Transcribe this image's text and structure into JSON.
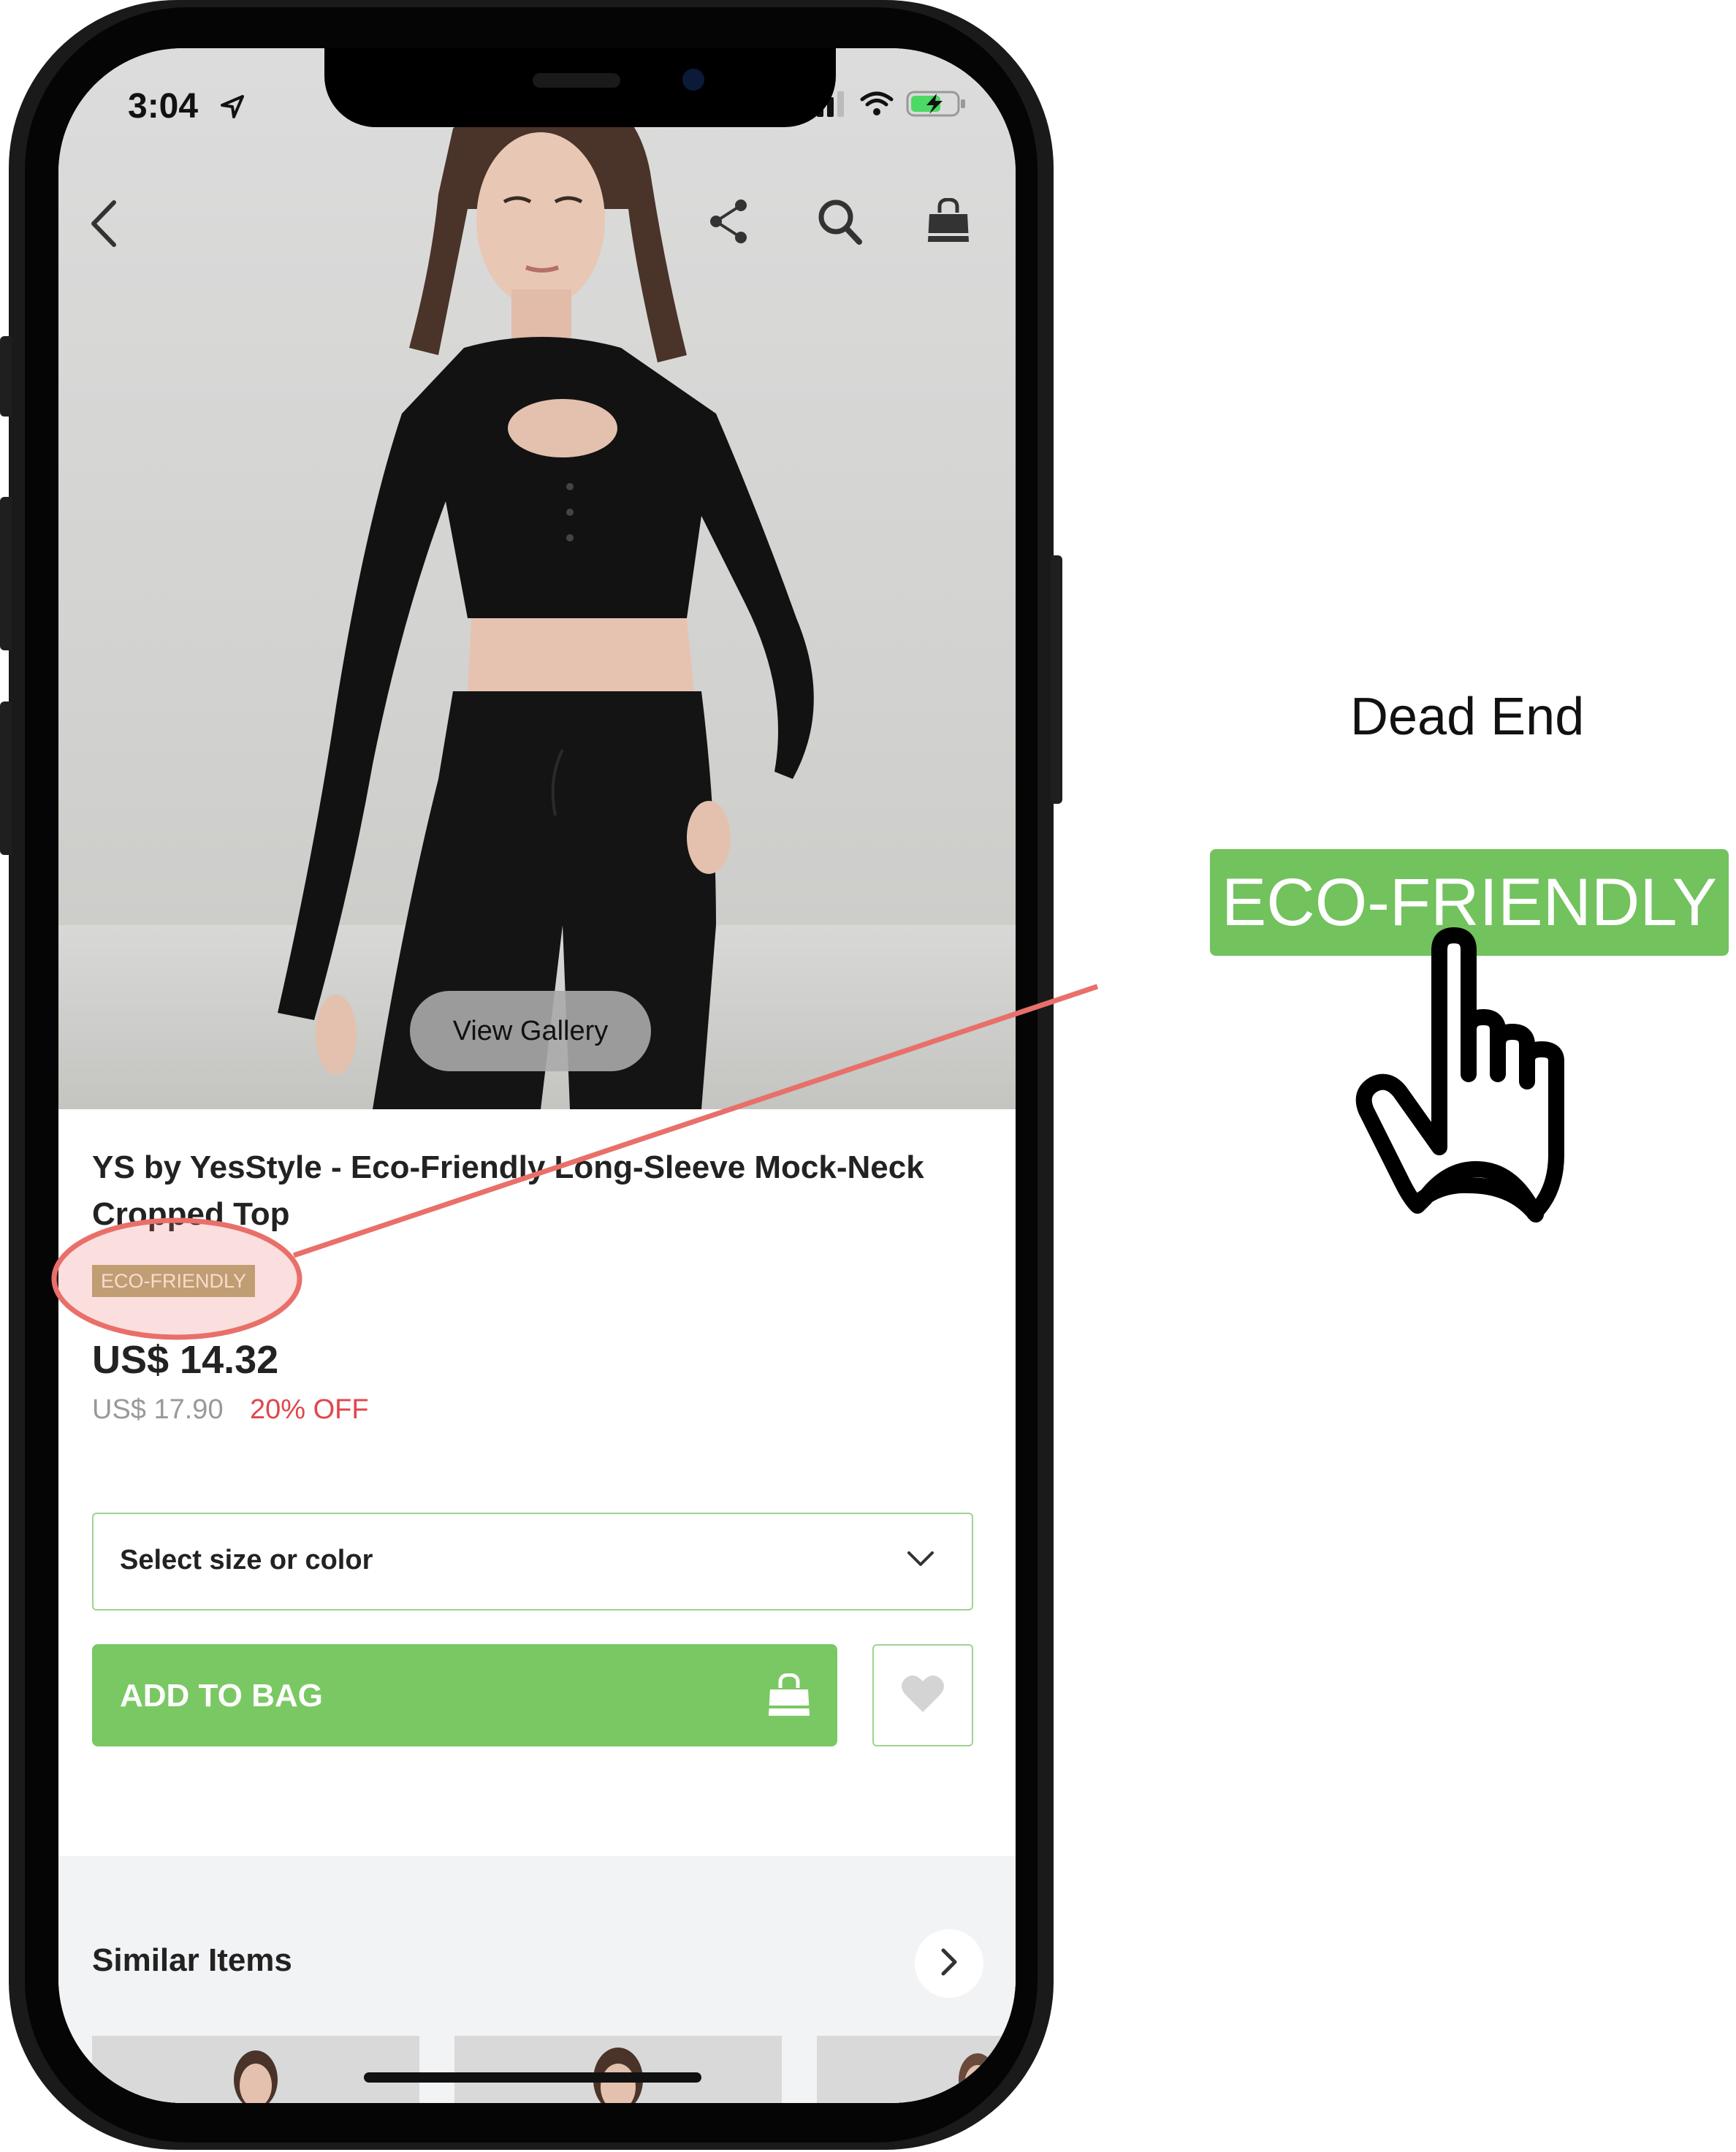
{
  "status_bar": {
    "time": "3:04"
  },
  "hero": {
    "view_gallery_label": "View Gallery"
  },
  "product": {
    "title": "YS by YesStyle - Eco-Friendly Long-Sleeve Mock-Neck Cropped Top",
    "badge": "ECO-FRIENDLY",
    "price": "US$ 14.32",
    "original_price": "US$ 17.90",
    "discount": "20% OFF"
  },
  "selector": {
    "label": "Select size or color"
  },
  "actions": {
    "add_to_bag_label": "ADD TO BAG"
  },
  "similar": {
    "title": "Similar Items"
  },
  "annotation": {
    "heading": "Dead End",
    "badge_zoom": "ECO-FRIENDLY",
    "colors": {
      "highlight": "#e96f6a",
      "badge_green": "#72c25d"
    }
  },
  "icons": [
    "back-icon",
    "share-icon",
    "search-icon",
    "bag-icon",
    "chevron-down-icon",
    "bag-icon",
    "heart-icon",
    "chevron-right-icon",
    "hand-pointer-icon"
  ],
  "colors": {
    "accent": "#7ac863",
    "badge": "#b6ab78",
    "discount": "#e0464a"
  }
}
